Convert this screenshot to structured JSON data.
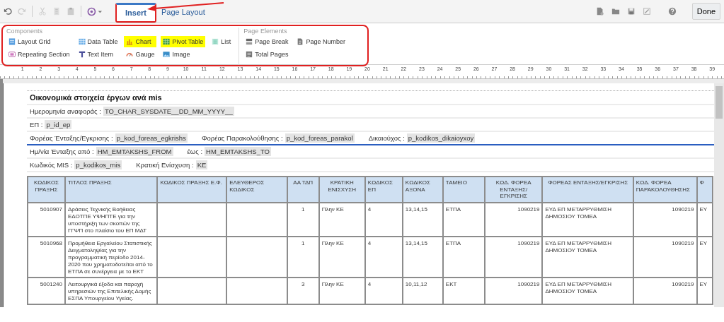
{
  "toolbar": {
    "tabs": [
      {
        "label": "Insert",
        "selected": true
      },
      {
        "label": "Page Layout",
        "selected": false
      }
    ],
    "done_button": "Done"
  },
  "ribbon": {
    "groups": [
      {
        "title": "Components",
        "items": [
          {
            "label": "Layout Grid",
            "highlighted": false
          },
          {
            "label": "Repeating Section",
            "highlighted": false
          },
          {
            "label": "Data Table",
            "highlighted": false
          },
          {
            "label": "Text Item",
            "highlighted": false
          },
          {
            "label": "Chart",
            "highlighted": true
          },
          {
            "label": "Gauge",
            "highlighted": false
          },
          {
            "label": "Pivot Table",
            "highlighted": true
          },
          {
            "label": "Image",
            "highlighted": false
          },
          {
            "label": "List",
            "highlighted": false
          }
        ]
      },
      {
        "title": "Page Elements",
        "items": [
          {
            "label": "Page Break",
            "highlighted": false
          },
          {
            "label": "Total Pages",
            "highlighted": false
          },
          {
            "label": "Page Number",
            "highlighted": false
          }
        ]
      }
    ]
  },
  "ruler": {
    "marks": [
      "1",
      "2",
      "3",
      "4",
      "5",
      "6",
      "7",
      "8",
      "9",
      "10",
      "11",
      "12",
      "13",
      "14",
      "15",
      "16",
      "17",
      "18",
      "19",
      "20",
      "21",
      "22",
      "23",
      "24",
      "25",
      "26",
      "27",
      "28",
      "29",
      "30",
      "31",
      "32",
      "33",
      "34",
      "35",
      "36",
      "37",
      "38",
      "39"
    ]
  },
  "report": {
    "title": "Οικονομικά στοιχεία έργων ανά mis",
    "lines": [
      {
        "selected": false,
        "fields": [
          {
            "label": "Ημερομηνία αναφοράς :",
            "value": "TO_CHAR_SYSDATE__DD_MM_YYYY__"
          }
        ]
      },
      {
        "selected": false,
        "fields": [
          {
            "label": "ΕΠ :",
            "value": "p_id_ep"
          }
        ]
      },
      {
        "selected": true,
        "fields": [
          {
            "label": "Φορέας Ένταξης/Εγκρισης :",
            "value": "p_kod_foreas_egkrishs"
          },
          {
            "label": "Φορέας Παρακολούθησης :",
            "value": "p_kod_foreas_parakol"
          },
          {
            "label": "Δικαιούχος :",
            "value": "p_kodikos_dikaioyxoy"
          }
        ]
      },
      {
        "selected": false,
        "fields": [
          {
            "label": "Ημ/νία Ένταξης από :",
            "value": "HM_EMTAKSHS_FROM"
          },
          {
            "label": "έως :",
            "value": "HM_EMTAKSHS_TO"
          }
        ]
      },
      {
        "selected": false,
        "fields": [
          {
            "label": "Κωδικός MIS :",
            "value": "p_kodikos_mis"
          },
          {
            "label": "Κρατική Ενίσχυση :",
            "value": "KE"
          }
        ]
      }
    ]
  },
  "table": {
    "columns": [
      {
        "label": "ΚΩΔΙΚΟΣ ΠΡΑΞΗΣ"
      },
      {
        "label": "ΤΙΤΛΟΣ ΠΡΑΞΗΣ"
      },
      {
        "label": "ΚΩΔΙΚΟΣ ΠΡΑΞΗΣ Ε.Φ."
      },
      {
        "label": "ΕΛΕΥΘΕΡΟΣ ΚΩΔΙΚΟΣ"
      },
      {
        "label": "ΑΑ ΤΔΠ"
      },
      {
        "label": "ΚΡΑΤΙΚΗ ΕΝΙΣΧΥΣΗ"
      },
      {
        "label": "ΚΩΔΙΚΟΣ ΕΠ"
      },
      {
        "label": "ΚΩΔΙΚΟΣ ΑΞΟΝΑ"
      },
      {
        "label": "ΤΑΜΕΙΟ"
      },
      {
        "label": "ΚΩΔ. ΦΟΡΕΑ ΕΝΤΑΞΗΣ/ΕΓΚΡΙΣΗΣ"
      },
      {
        "label": "ΦΟΡΕΑΣ ΕΝΤΑΞΗΣ/ΕΓΚΡΙΣΗΣ"
      },
      {
        "label": "ΚΩΔ. ΦΟΡΕΑ ΠΑΡΑΚΟΛΟΥΘΗΣΗΣ"
      },
      {
        "label": "Φ"
      }
    ],
    "rows": [
      [
        "5010907",
        "Δράσεις Τεχνικής Βοήθειας ΕΔΟΤΠΕ ΥΨΗΠΤΕ για την υποστήριξη των σκοπών της ΓΓΨΠ στο πλαίσιο του ΕΠ ΜΔΤ",
        "",
        "",
        "1",
        "Πλην ΚΕ",
        "4",
        "13,14,15",
        "ΕΤΠΑ",
        "1090219",
        "ΕΥΔ ΕΠ ΜΕΤΑΡΡΥΘΜΙΣΗ ΔΗΜΟΣΙΟΥ ΤΟΜΕΑ",
        "1090219",
        "ΕΥ"
      ],
      [
        "5010968",
        "Προμήθεια Εργαλείου Στατιστικής Δειγματοληψίας για την προγραμματική περίοδο 2014-2020 που χρηματοδοτείται από το ΕΤΠΑ σε συνέργεια με το ΕΚΤ",
        "",
        "",
        "1",
        "Πλην ΚΕ",
        "4",
        "13,14,15",
        "ΕΤΠΑ",
        "1090219",
        "ΕΥΔ ΕΠ ΜΕΤΑΡΡΥΘΜΙΣΗ ΔΗΜΟΣΙΟΥ ΤΟΜΕΑ",
        "1090219",
        "ΕΥ"
      ],
      [
        "5001240",
        "Λειτουργικά έξοδα και παροχή υπηρεσιών της Επιτελικής Δομής ΕΣΠΑ Υπουργείου Υγείας.",
        "",
        "",
        "3",
        "Πλην ΚΕ",
        "4",
        "10,11,12",
        "ΕΚΤ",
        "1090219",
        "ΕΥΔ ΕΠ ΜΕΤΑΡΡΥΘΜΙΣΗ ΔΗΜΟΣΙΟΥ ΤΟΜΕΑ",
        "1090219",
        "ΕΥ"
      ]
    ]
  }
}
